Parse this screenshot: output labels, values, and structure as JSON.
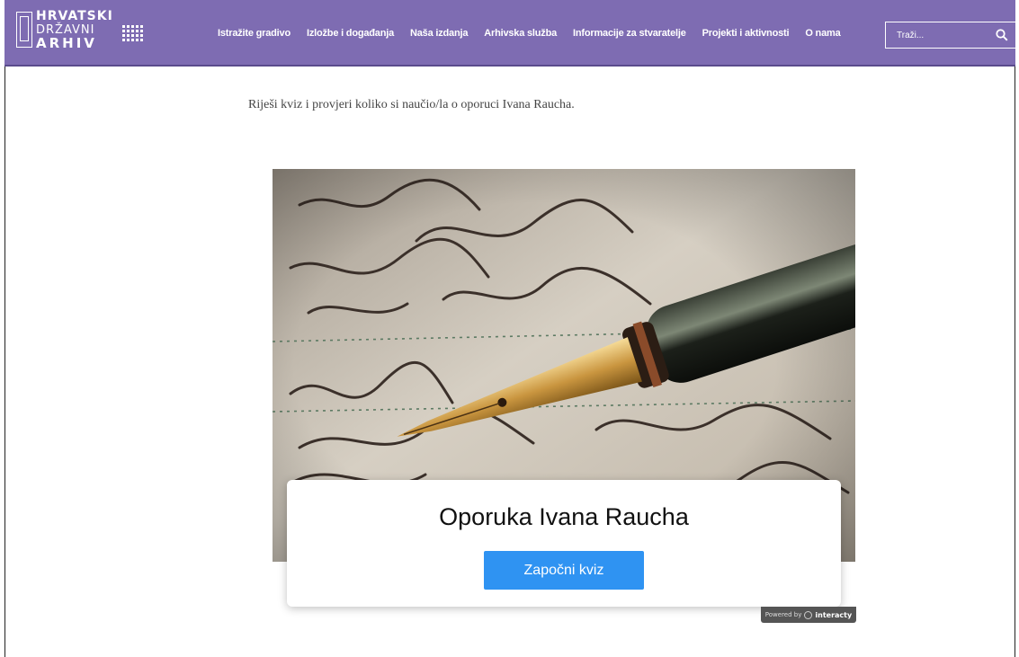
{
  "header": {
    "logo_lines": [
      "HRVATSKI",
      "DRŽAVNI",
      "ARHIV"
    ],
    "nav": [
      "Istražite gradivo",
      "Izložbe i događanja",
      "Naša izdanja",
      "Arhivska služba",
      "Informacije za stvaratelje",
      "Projekti i aktivnosti",
      "O nama"
    ],
    "search_placeholder": "Traži..."
  },
  "main": {
    "intro": "Riješi kviz i provjeri koliko si naučio/la o oporuci Ivana Raucha."
  },
  "quiz": {
    "title": "Oporuka Ivana Raucha",
    "start_label": "Započni kviz",
    "powered_prefix": "Powered by",
    "powered_brand": "interacty"
  },
  "colors": {
    "header_bg": "#7e6cb2",
    "button_bg": "#2f93f2"
  }
}
